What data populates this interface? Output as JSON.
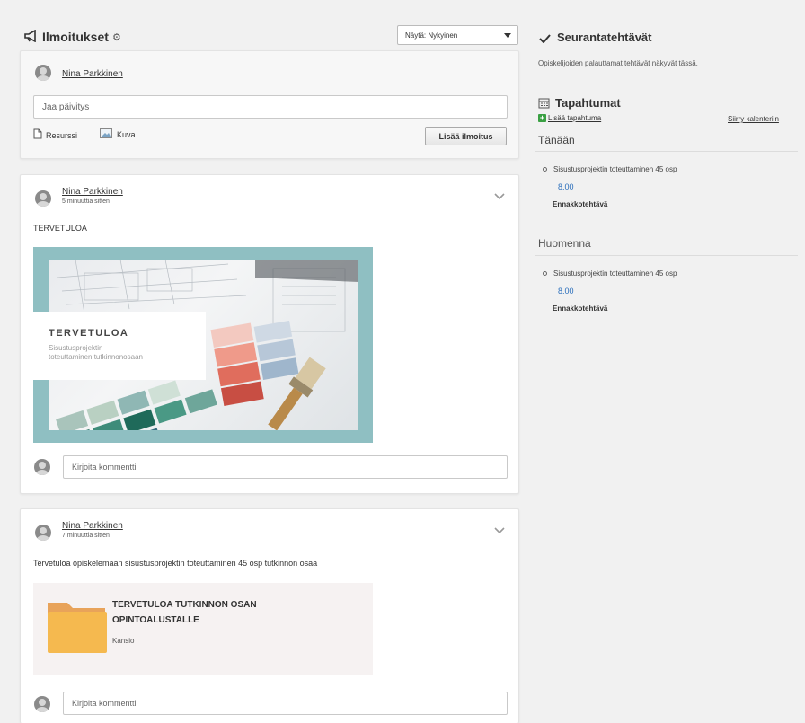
{
  "announcements": {
    "title": "Ilmoitukset",
    "filter_label": "Näytä: Nykyinen",
    "composer": {
      "author": "Nina Parkkinen",
      "placeholder": "Jaa päivitys",
      "resource_label": "Resurssi",
      "image_label": "Kuva",
      "submit_label": "Lisää ilmoitus"
    }
  },
  "posts": [
    {
      "author": "Nina Parkkinen",
      "time": "5 minuuttia sitten",
      "text": "TERVETULOA",
      "image": {
        "heading": "TERVETULOA",
        "subtitle_line1": "Sisustusprojektin",
        "subtitle_line2": "toteuttaminen tutkinnonosaan"
      },
      "comment_placeholder": "Kirjoita kommentti"
    },
    {
      "author": "Nina Parkkinen",
      "time": "7 minuuttia sitten",
      "text": "Tervetuloa opiskelemaan sisustusprojektin toteuttaminen 45 osp tutkinnon osaa",
      "folder": {
        "title_line1": "TERVETULOA TUTKINNON OSAN",
        "title_line2": "OPINTOALUSTALLE",
        "type": "Kansio"
      },
      "comment_placeholder": "Kirjoita kommentti"
    }
  ],
  "sidebar": {
    "tracking": {
      "title": "Seurantatehtävät",
      "description": "Opiskelijoiden palauttamat tehtävät näkyvät tässä."
    },
    "events": {
      "title": "Tapahtumat",
      "add_label": "Lisää tapahtuma",
      "calendar_link": "Siirry kalenteriin",
      "groups": [
        {
          "heading": "Tänään",
          "items": [
            {
              "title": "Sisustusprojektin toteuttaminen 45 osp",
              "time": "8.00",
              "type": "Ennakkotehtävä"
            }
          ]
        },
        {
          "heading": "Huomenna",
          "items": [
            {
              "title": "Sisustusprojektin toteuttaminen 45 osp",
              "time": "8.00",
              "type": "Ennakkotehtävä"
            }
          ]
        }
      ]
    }
  },
  "colors": {
    "accent_link": "#2a6ebb",
    "add_icon": "#3aa043",
    "image_frame": "#8fbfc2",
    "folder": "#f5b94f"
  }
}
